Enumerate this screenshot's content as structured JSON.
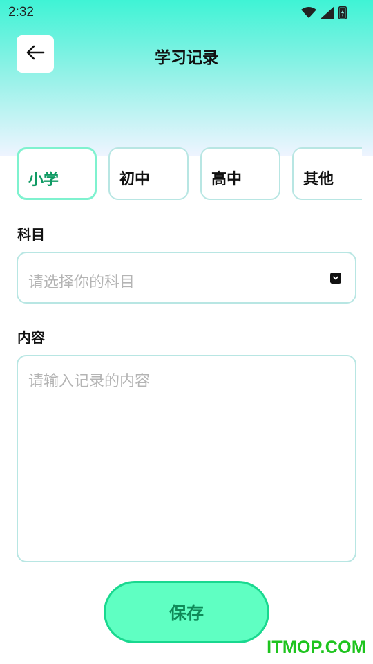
{
  "status_bar": {
    "time": "2:32",
    "icons": [
      "wifi-icon",
      "signal-icon",
      "battery-icon"
    ]
  },
  "header": {
    "title": "学习记录",
    "back_icon": "arrow-left-icon"
  },
  "levels": [
    {
      "label": "小学",
      "selected": true
    },
    {
      "label": "初中",
      "selected": false
    },
    {
      "label": "高中",
      "selected": false
    },
    {
      "label": "其他",
      "selected": false
    }
  ],
  "subject": {
    "label": "科目",
    "placeholder": "请选择你的科目"
  },
  "content": {
    "label": "内容",
    "placeholder": "请输入记录的内容"
  },
  "save_label": "保存",
  "watermark": "ITMOP.COM",
  "colors": {
    "accent": "#5fffc2",
    "accent_text": "#0f8a58",
    "selected_tab_text": "#0f9a63",
    "border": "#b8e6e3"
  }
}
